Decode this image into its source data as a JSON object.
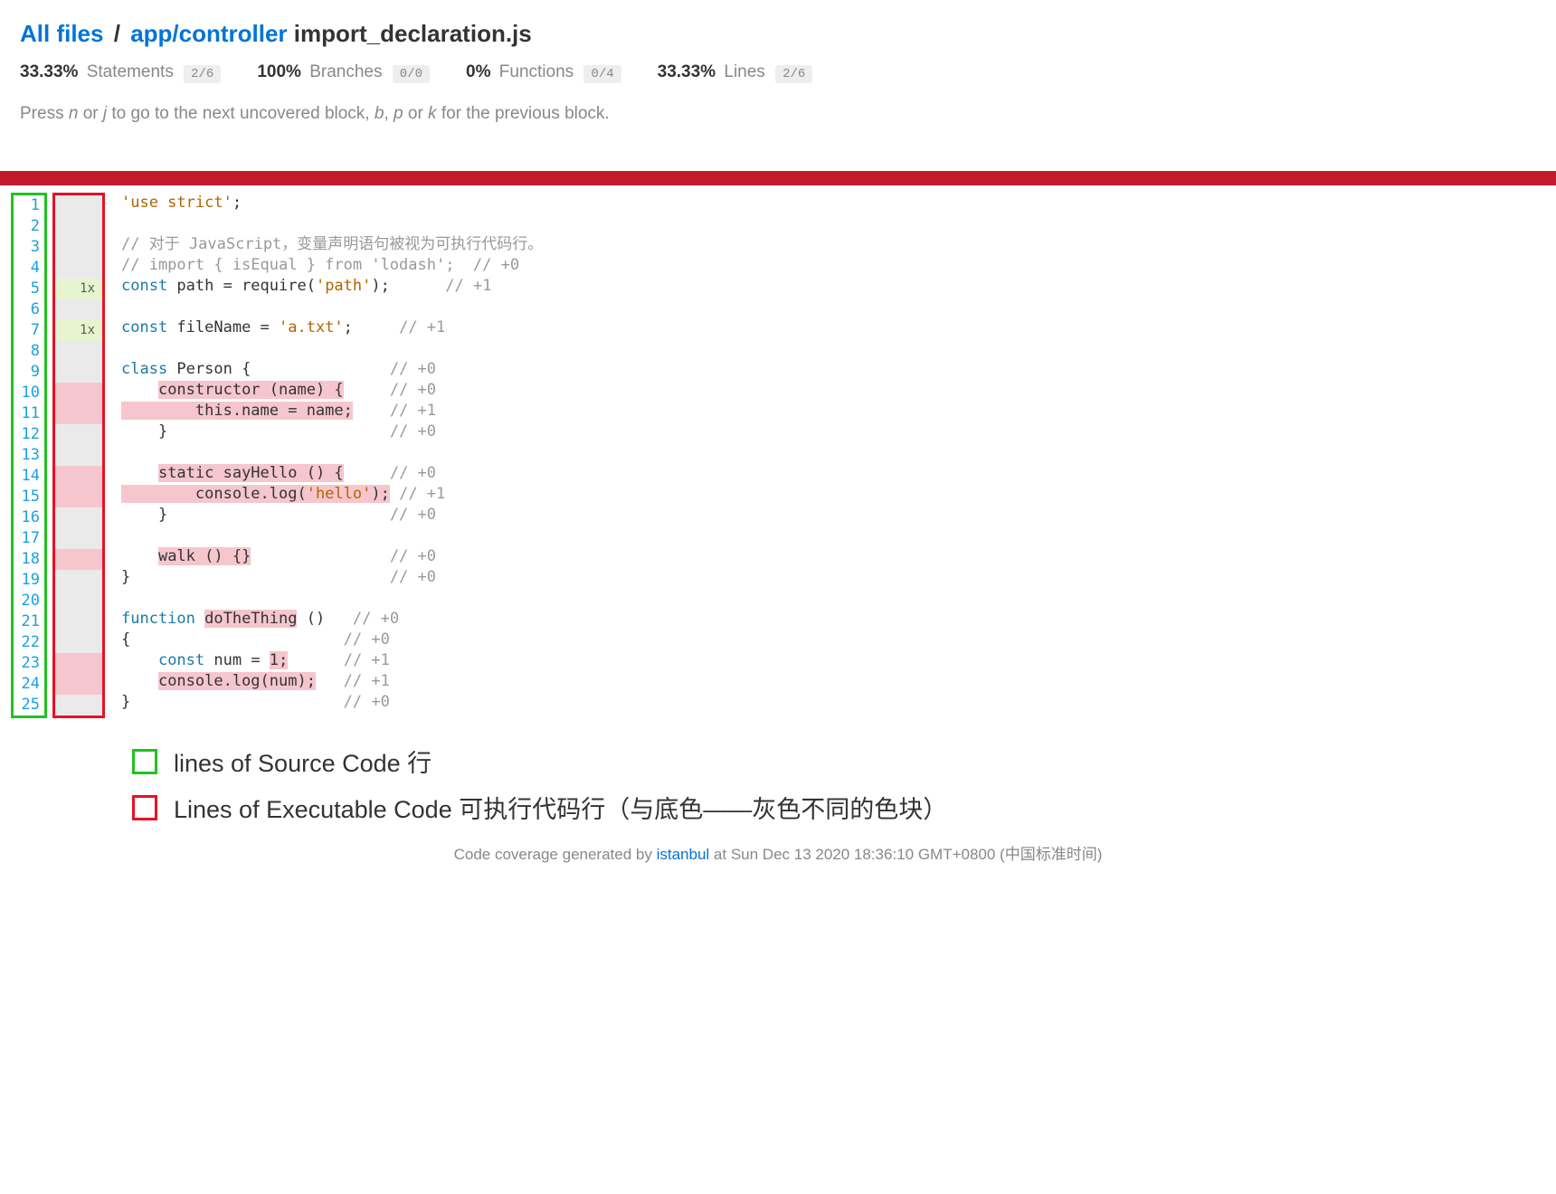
{
  "breadcrumb": {
    "root": "All files",
    "path": "app/controller",
    "file": "import_declaration.js"
  },
  "metrics": {
    "statements": {
      "pct": "33.33%",
      "label": "Statements",
      "fraction": "2/6"
    },
    "branches": {
      "pct": "100%",
      "label": "Branches",
      "fraction": "0/0"
    },
    "functions": {
      "pct": "0%",
      "label": "Functions",
      "fraction": "0/4"
    },
    "lines": {
      "pct": "33.33%",
      "label": "Lines",
      "fraction": "2/6"
    }
  },
  "hint": {
    "pre": "Press ",
    "k1": "n",
    "or1": " or ",
    "k2": "j",
    "mid": " to go to the next uncovered block, ",
    "k3": "b",
    "c1": ", ",
    "k4": "p",
    "or2": " or ",
    "k5": "k",
    "post": " for the previous block."
  },
  "code": {
    "lines": [
      {
        "n": 1,
        "cnt": "",
        "cntClass": "",
        "tokens": [
          {
            "cls": "str",
            "t": "'use strict'"
          },
          {
            "cls": "",
            "t": ";"
          }
        ]
      },
      {
        "n": 2,
        "cnt": "",
        "cntClass": "",
        "tokens": [
          {
            "cls": "",
            "t": " "
          }
        ]
      },
      {
        "n": 3,
        "cnt": "",
        "cntClass": "",
        "tokens": [
          {
            "cls": "com",
            "t": "// 对于 JavaScript，变量声明语句被视为可执行代码行。"
          }
        ]
      },
      {
        "n": 4,
        "cnt": "",
        "cntClass": "",
        "tokens": [
          {
            "cls": "com",
            "t": "// import { isEqual } from 'lodash';  // +0"
          }
        ]
      },
      {
        "n": 5,
        "cnt": "1x",
        "cntClass": "hit",
        "tokens": [
          {
            "cls": "kw",
            "t": "const "
          },
          {
            "cls": "",
            "t": "path = require("
          },
          {
            "cls": "str",
            "t": "'path'"
          },
          {
            "cls": "",
            "t": ");      "
          },
          {
            "cls": "com",
            "t": "// +1"
          }
        ]
      },
      {
        "n": 6,
        "cnt": "",
        "cntClass": "",
        "tokens": [
          {
            "cls": "",
            "t": " "
          }
        ]
      },
      {
        "n": 7,
        "cnt": "1x",
        "cntClass": "hit",
        "tokens": [
          {
            "cls": "kw",
            "t": "const "
          },
          {
            "cls": "",
            "t": "fileName = "
          },
          {
            "cls": "str",
            "t": "'a.txt'"
          },
          {
            "cls": "",
            "t": ";     "
          },
          {
            "cls": "com",
            "t": "// +1"
          }
        ]
      },
      {
        "n": 8,
        "cnt": "",
        "cntClass": "",
        "tokens": [
          {
            "cls": "",
            "t": " "
          }
        ]
      },
      {
        "n": 9,
        "cnt": "",
        "cntClass": "",
        "tokens": [
          {
            "cls": "kw",
            "t": "class "
          },
          {
            "cls": "fn",
            "t": "Person"
          },
          {
            "cls": "",
            "t": " {               "
          },
          {
            "cls": "com",
            "t": "// +0"
          }
        ]
      },
      {
        "n": 10,
        "cnt": "",
        "cntClass": "miss",
        "tokens": [
          {
            "cls": "",
            "t": "    "
          },
          {
            "cls": "miss-span",
            "t": "constructor (name) {"
          },
          {
            "cls": "",
            "t": "     "
          },
          {
            "cls": "com",
            "t": "// +0"
          }
        ]
      },
      {
        "n": 11,
        "cnt": "",
        "cntClass": "miss",
        "tokens": [
          {
            "cls": "miss-span",
            "t": "        this.name = name;"
          },
          {
            "cls": "",
            "t": "    "
          },
          {
            "cls": "com",
            "t": "// +1"
          }
        ]
      },
      {
        "n": 12,
        "cnt": "",
        "cntClass": "",
        "tokens": [
          {
            "cls": "",
            "t": "    }                        "
          },
          {
            "cls": "com",
            "t": "// +0"
          }
        ]
      },
      {
        "n": 13,
        "cnt": "",
        "cntClass": "",
        "tokens": [
          {
            "cls": "",
            "t": " "
          }
        ]
      },
      {
        "n": 14,
        "cnt": "",
        "cntClass": "miss",
        "tokens": [
          {
            "cls": "",
            "t": "    "
          },
          {
            "cls": "miss-span",
            "t": "static sayHello () {"
          },
          {
            "cls": "",
            "t": "     "
          },
          {
            "cls": "com",
            "t": "// +0"
          }
        ]
      },
      {
        "n": 15,
        "cnt": "",
        "cntClass": "miss",
        "tokens": [
          {
            "cls": "miss-span",
            "t": "        console.log("
          },
          {
            "cls": "str miss-span",
            "t": "'hello'"
          },
          {
            "cls": "miss-span",
            "t": ");"
          },
          {
            "cls": "",
            "t": " "
          },
          {
            "cls": "com",
            "t": "// +1"
          }
        ]
      },
      {
        "n": 16,
        "cnt": "",
        "cntClass": "",
        "tokens": [
          {
            "cls": "",
            "t": "    }                        "
          },
          {
            "cls": "com",
            "t": "// +0"
          }
        ]
      },
      {
        "n": 17,
        "cnt": "",
        "cntClass": "",
        "tokens": [
          {
            "cls": "",
            "t": " "
          }
        ]
      },
      {
        "n": 18,
        "cnt": "",
        "cntClass": "miss",
        "tokens": [
          {
            "cls": "",
            "t": "    "
          },
          {
            "cls": "miss-span",
            "t": "walk () {}"
          },
          {
            "cls": "",
            "t": "               "
          },
          {
            "cls": "com",
            "t": "// +0"
          }
        ]
      },
      {
        "n": 19,
        "cnt": "",
        "cntClass": "",
        "tokens": [
          {
            "cls": "",
            "t": "}                            "
          },
          {
            "cls": "com",
            "t": "// +0"
          }
        ]
      },
      {
        "n": 20,
        "cnt": "",
        "cntClass": "",
        "tokens": [
          {
            "cls": "",
            "t": " "
          }
        ]
      },
      {
        "n": 21,
        "cnt": "",
        "cntClass": "",
        "tokens": [
          {
            "cls": "kw",
            "t": "function "
          },
          {
            "cls": "miss-sym",
            "t": "doTheThing"
          },
          {
            "cls": "",
            "t": " ()   "
          },
          {
            "cls": "com",
            "t": "// +0"
          }
        ]
      },
      {
        "n": 22,
        "cnt": "",
        "cntClass": "",
        "tokens": [
          {
            "cls": "",
            "t": "{                       "
          },
          {
            "cls": "com",
            "t": "// +0"
          }
        ]
      },
      {
        "n": 23,
        "cnt": "",
        "cntClass": "miss",
        "tokens": [
          {
            "cls": "",
            "t": "    "
          },
          {
            "cls": "kw",
            "t": "const "
          },
          {
            "cls": "",
            "t": "num = "
          },
          {
            "cls": "miss-sym",
            "t": "1;"
          },
          {
            "cls": "",
            "t": "      "
          },
          {
            "cls": "com",
            "t": "// +1"
          }
        ]
      },
      {
        "n": 24,
        "cnt": "",
        "cntClass": "miss",
        "tokens": [
          {
            "cls": "",
            "t": "    "
          },
          {
            "cls": "miss-span",
            "t": "console.log(num);"
          },
          {
            "cls": "",
            "t": "   "
          },
          {
            "cls": "com",
            "t": "// +1"
          }
        ]
      },
      {
        "n": 25,
        "cnt": "",
        "cntClass": "",
        "tokens": [
          {
            "cls": "",
            "t": "}                       "
          },
          {
            "cls": "com",
            "t": "// +0"
          }
        ]
      }
    ]
  },
  "legend": {
    "green": "lines of Source Code 行",
    "red": "Lines of Executable Code 可执行代码行（与底色——灰色不同的色块）"
  },
  "footer": {
    "pre": "Code coverage generated by ",
    "tool": "istanbul",
    "at": " at Sun Dec 13 2020 18:36:10 GMT+0800 (中国标准时间)"
  }
}
